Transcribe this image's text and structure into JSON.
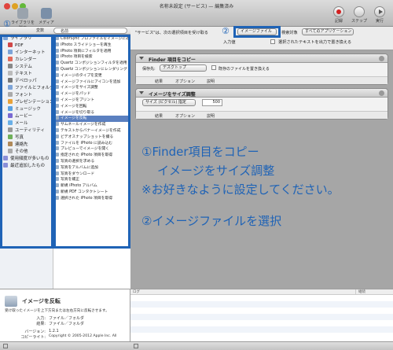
{
  "window": {
    "title": "名称未設定 (サービス) — 編集済み"
  },
  "toolbar": {
    "hide_library": "ライブラリを隠す",
    "media": "メディア",
    "record": "記録",
    "step": "ステップ",
    "run": "実行"
  },
  "library": {
    "header_label": "変数",
    "search_placeholder": "名前",
    "items": [
      "ライブラリ",
      "PDF",
      "インターネット",
      "カレンダー",
      "システム",
      "テキスト",
      "デベロッパ",
      "ファイルとフォルダ",
      "フォント",
      "プレゼンテーション",
      "ミュージック",
      "ムービー",
      "メール",
      "ユーティリティ",
      "写真",
      "連絡先",
      "その他",
      "使用頻度が多いもの",
      "最近追加したもの"
    ]
  },
  "actions": {
    "items": [
      "ColorSync プロファイルをイメージに適用",
      "iPhoto スライドショーを再生",
      "iPhoto 項目にフィルタを適用",
      "iPhoto 項目を検索",
      "Quartz コンポジションフィルタを適用",
      "Quartz コンポジションにレンダリング",
      "イメージのタイプを変更",
      "イメージファイルにアイコンを追加",
      "イメージをサイズ調整",
      "イメージをパッド",
      "イメージをプリント",
      "イメージを回転",
      "イメージを切り取る",
      "イメージを反転",
      "サムネールイメージを作成",
      "テキストからバナーイメージを作成",
      "ビデオスナップショットを撮る",
      "ファイルを iPhoto に読み込む",
      "プレビューでイメージを開く",
      "指定された iPhoto 項目を取得",
      "写真の選択を求める",
      "写真をアルバムに追加",
      "写真をダウンロード",
      "写真を補正",
      "新規 iPhoto アルバム",
      "新規 PDF コンタクトシート",
      "選択された iPhoto 項目を取得"
    ],
    "selected": "イメージを反転"
  },
  "description": {
    "title": "イメージを反転",
    "text": "受け取ったイメージを上下方向または左右方向に反転させます。",
    "input_label": "入力:",
    "input_value": "ファイル／フォルダ",
    "output_label": "結果:",
    "output_value": "ファイル／フォルダ",
    "version_label": "バージョン:",
    "version_value": "1.2.1",
    "copyright_label": "コピーライト:",
    "copyright_value": "Copyright © 2005-2012 Apple Inc. All"
  },
  "banner": {
    "service_prefix": "\"サービス\"は、次の選択項目を受け取る",
    "input_type": "イメージファイル",
    "target_prefix": "検索対象",
    "target_app": "すべてのアプリケーション",
    "input_label": "入力値",
    "replace_label": "選択されたテキストを出力で置き換える"
  },
  "workflow": {
    "card1": {
      "title": "Finder 項目をコピー",
      "dest_label": "保存先:",
      "dest_value": "デスクトップ",
      "replace_label": "既存のファイルを置き換える",
      "tabs": [
        "結果",
        "オプション",
        "説明"
      ]
    },
    "card2": {
      "title": "イメージをサイズ調整",
      "mode_value": "サイズ (ピクセル) 指定",
      "size_value": "500",
      "tabs": [
        "結果",
        "オプション",
        "説明"
      ]
    }
  },
  "overlay": {
    "line1": "①Finder項目をコピー",
    "line2": "イメージをサイズ調整",
    "line3": "※お好きなように設定してください。",
    "line4": "②イメージファイルを選択",
    "badge1": "①",
    "badge2": "②"
  },
  "log": {
    "col_log": "ログ",
    "col_duration": "継続"
  },
  "colors": {
    "annotation": "#1f63b6",
    "selection": "#5b80c0"
  }
}
